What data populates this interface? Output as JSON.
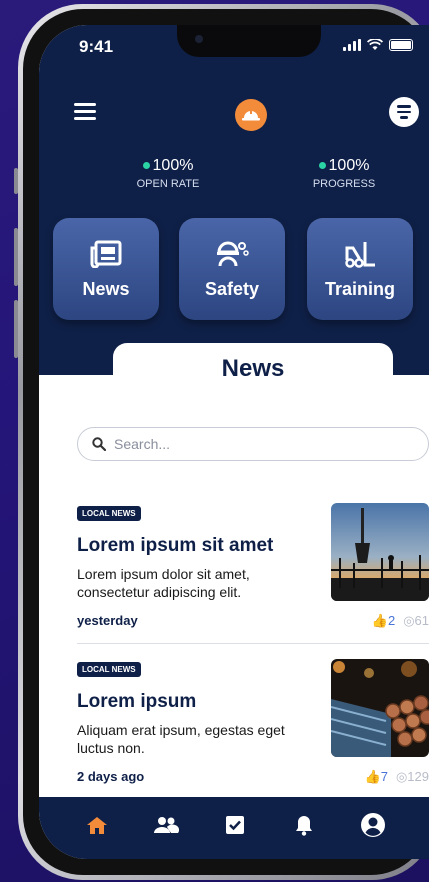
{
  "status": {
    "time": "9:41"
  },
  "header": {
    "stats": [
      {
        "value": "100%",
        "label": "OPEN RATE"
      },
      {
        "value": "100%",
        "label": "PROGRESS"
      }
    ],
    "tiles": [
      {
        "label": "News",
        "icon": "newspaper-icon"
      },
      {
        "label": "Safety",
        "icon": "safety-worker-icon"
      },
      {
        "label": "Training",
        "icon": "forklift-icon"
      }
    ],
    "section_title": "News"
  },
  "search": {
    "placeholder": "Search..."
  },
  "articles": [
    {
      "badge": "LOCAL NEWS",
      "title": "Lorem ipsum sit amet",
      "description": "Lorem ipsum dolor sit amet, consectetur adipiscing elit.",
      "time": "yesterday",
      "likes": "2",
      "views": "61"
    },
    {
      "badge": "LOCAL NEWS",
      "title": "Lorem ipsum",
      "description": "Aliquam erat ipsum, egestas eget luctus non.",
      "time": "2 days ago",
      "likes": "7",
      "views": "129"
    }
  ],
  "tabbar": {
    "items": [
      "home-icon",
      "people-icon",
      "checkbox-icon",
      "bell-icon",
      "account-icon"
    ],
    "active_color": "#f28b3a"
  },
  "colors": {
    "primary": "#0f2048",
    "accent": "#f28b3a",
    "online": "#2ad4a4",
    "tile": "#3a5596"
  }
}
